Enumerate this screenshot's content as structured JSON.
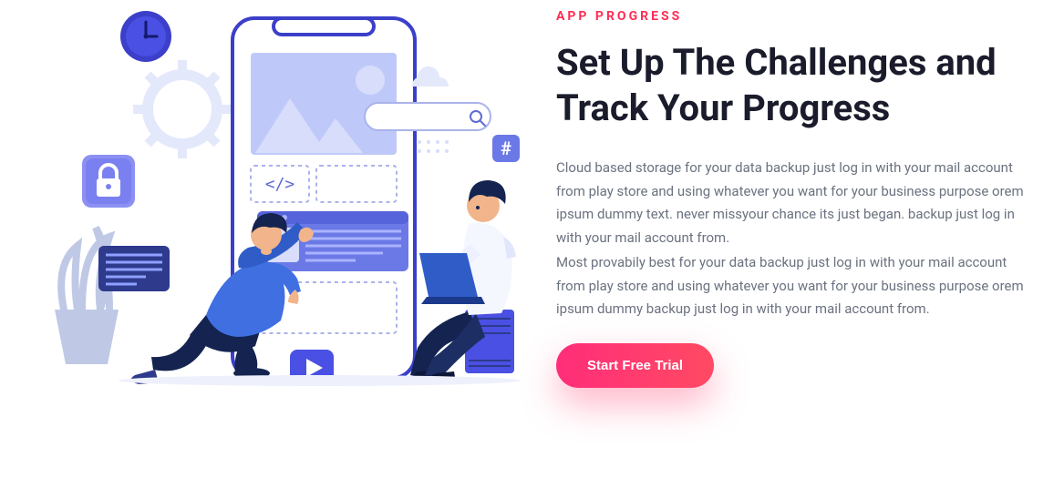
{
  "eyebrow": "APP PROGRESS",
  "headline": "Set Up The Challenges and Track Your Progress",
  "paragraph1": "Cloud based storage for your data backup just log in with your mail account from play store and using whatever you want for your business purpose orem ipsum dummy text. never missyour chance its just began. backup just log in with your mail account from.",
  "paragraph2": "Most provabily best for your data backup just log in with your mail account from play store and using whatever you want for your business purpose orem ipsum dummy backup just log in with your mail account from.",
  "cta_label": "Start Free Trial",
  "illustration": {
    "clock_icon": "clock",
    "gear_icon": "gear",
    "lock_icon": "lock",
    "data_card_icon": "data-lines",
    "play_icon": "play",
    "search_icon": "search",
    "hash_icon": "hash",
    "cloud_icon": "cloud",
    "code_icon": "code"
  }
}
